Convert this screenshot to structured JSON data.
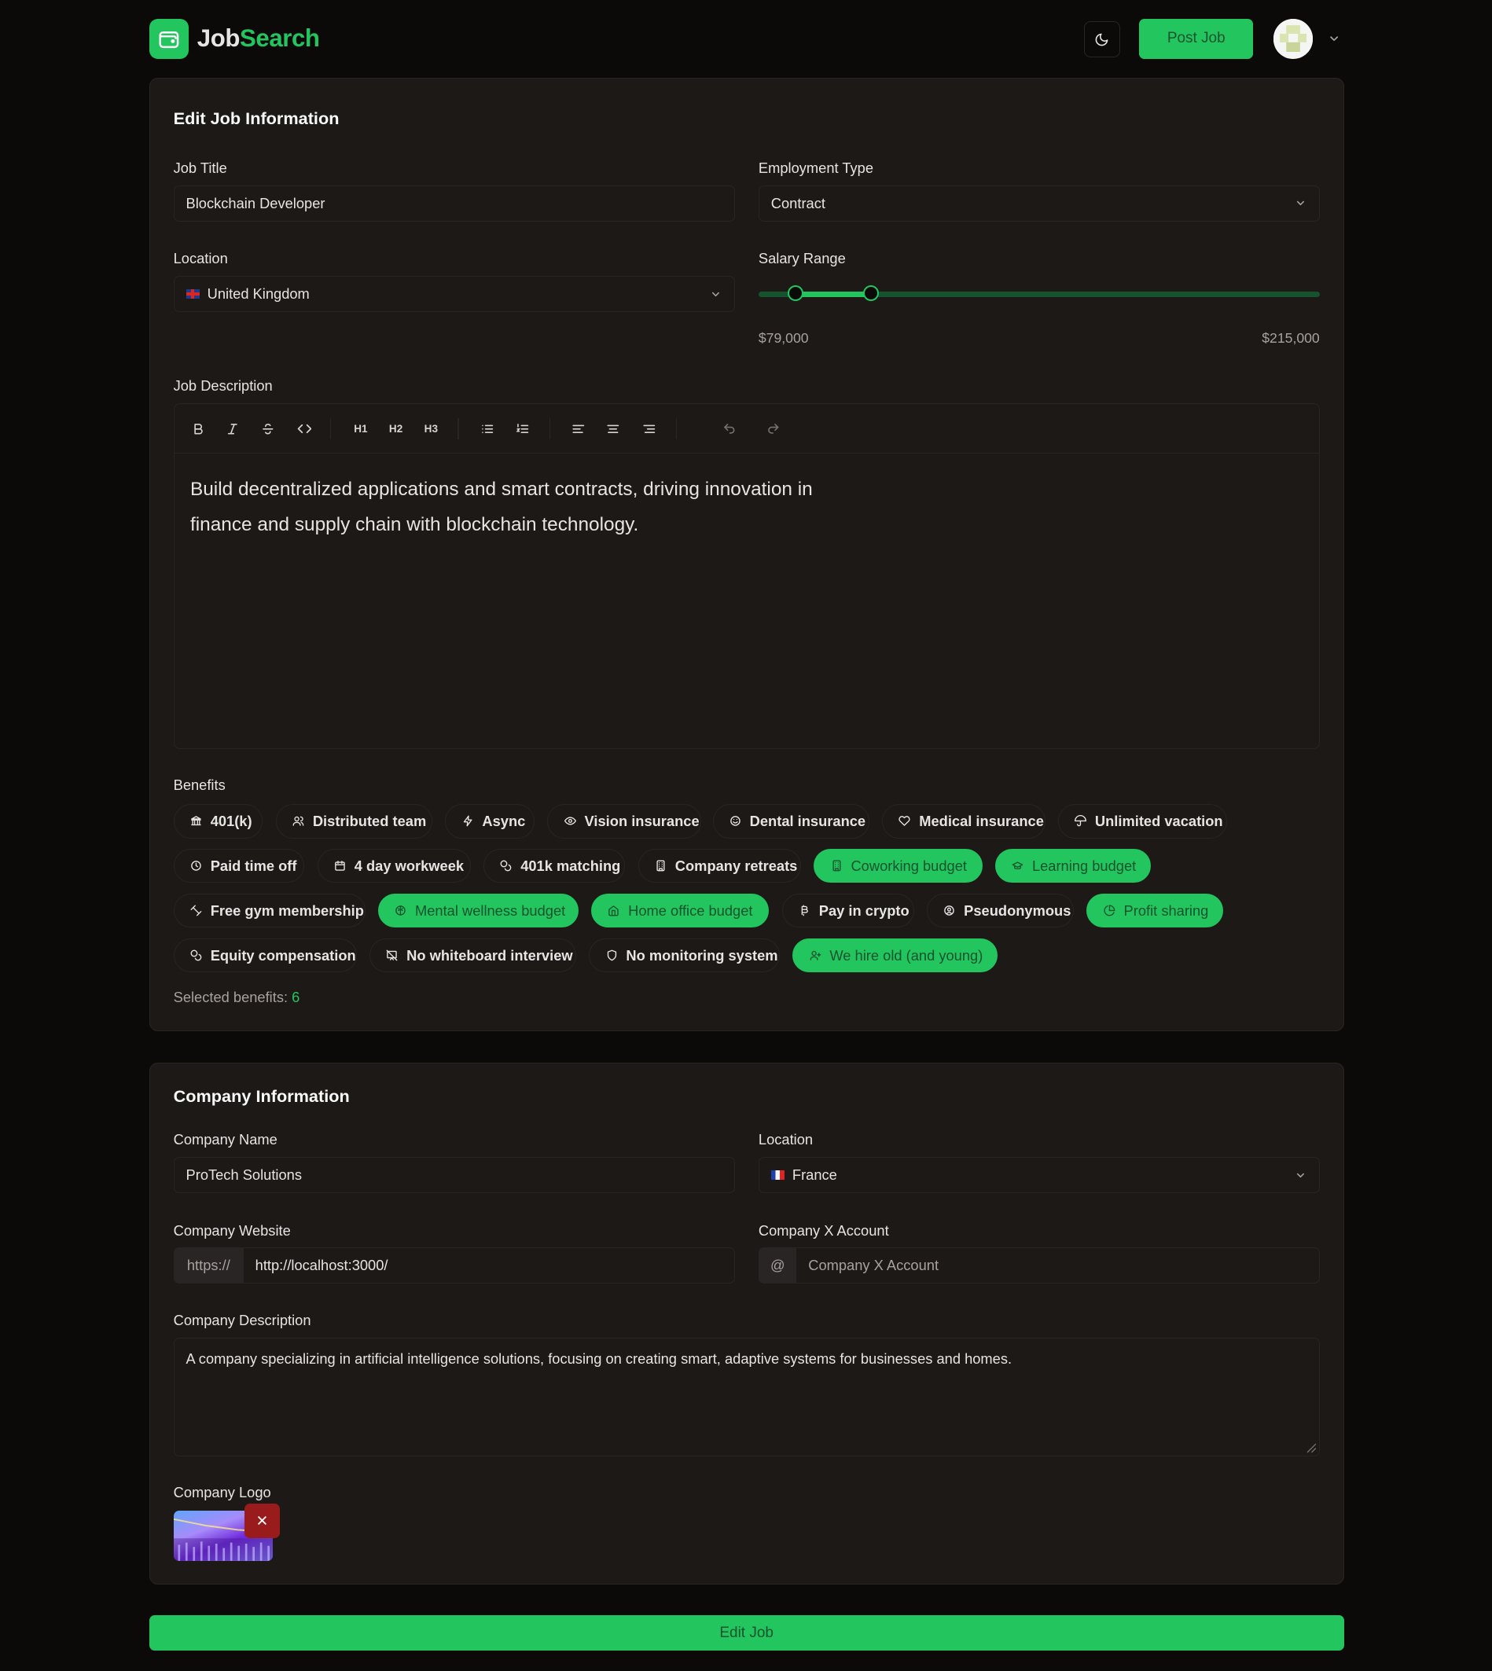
{
  "header": {
    "brand_part1": "Job",
    "brand_part2": "Search",
    "post_job_label": "Post Job",
    "accent": "#22c55e"
  },
  "job": {
    "title": "Edit Job Information",
    "job_title_label": "Job Title",
    "job_title_value": "Blockchain Developer",
    "employment_type_label": "Employment Type",
    "employment_type_value": "Contract",
    "location_label": "Location",
    "location_value": "United Kingdom",
    "salary_label": "Salary Range",
    "salary_min": "$79,000",
    "salary_max": "$215,000",
    "salary_range_low_fraction": 0.066,
    "salary_range_high_fraction": 0.2,
    "description_label": "Job Description",
    "description_text": "Build decentralized applications and smart contracts, driving innovation in finance and supply chain with blockchain technology.",
    "toolbar": {
      "h1": "H1",
      "h2": "H2",
      "h3": "H3"
    }
  },
  "benefits": {
    "label": "Benefits",
    "items": [
      {
        "label": "401(k)",
        "icon": "bank-icon",
        "selected": false
      },
      {
        "label": "Distributed team",
        "icon": "users-icon",
        "selected": false
      },
      {
        "label": "Async",
        "icon": "bolt-icon",
        "selected": false
      },
      {
        "label": "Vision insurance",
        "icon": "eye-icon",
        "selected": false
      },
      {
        "label": "Dental insurance",
        "icon": "smile-icon",
        "selected": false
      },
      {
        "label": "Medical insurance",
        "icon": "heart-icon",
        "selected": false
      },
      {
        "label": "Unlimited vacation",
        "icon": "umbrella-icon",
        "selected": false
      },
      {
        "label": "Paid time off",
        "icon": "clock-icon",
        "selected": false
      },
      {
        "label": "4 day workweek",
        "icon": "calendar-icon",
        "selected": false
      },
      {
        "label": "401k matching",
        "icon": "coins-icon",
        "selected": false
      },
      {
        "label": "Company retreats",
        "icon": "building-icon",
        "selected": false
      },
      {
        "label": "Coworking budget",
        "icon": "building-icon",
        "selected": true
      },
      {
        "label": "Learning budget",
        "icon": "graduation-cap-icon",
        "selected": true
      },
      {
        "label": "Free gym membership",
        "icon": "dumbbell-icon",
        "selected": false
      },
      {
        "label": "Mental wellness budget",
        "icon": "brain-icon",
        "selected": true
      },
      {
        "label": "Home office budget",
        "icon": "home-icon",
        "selected": true
      },
      {
        "label": "Pay in crypto",
        "icon": "bitcoin-icon",
        "selected": false
      },
      {
        "label": "Pseudonymous",
        "icon": "user-circle-icon",
        "selected": false
      },
      {
        "label": "Profit sharing",
        "icon": "pie-chart-icon",
        "selected": true
      },
      {
        "label": "Equity compensation",
        "icon": "coins-icon",
        "selected": false
      },
      {
        "label": "No whiteboard interview",
        "icon": "whiteboard-off-icon",
        "selected": false
      },
      {
        "label": "No monitoring system",
        "icon": "shield-icon",
        "selected": false
      },
      {
        "label": "We hire old (and young)",
        "icon": "user-plus-icon",
        "selected": true
      }
    ],
    "selected_label": "Selected benefits:",
    "selected_count": "6"
  },
  "company": {
    "title": "Company Information",
    "name_label": "Company Name",
    "name_value": "ProTech Solutions",
    "location_label": "Location",
    "location_value": "France",
    "website_label": "Company Website",
    "website_prefix": "https://",
    "website_value": "http://localhost:3000/",
    "x_label": "Company X Account",
    "x_prefix": "@",
    "x_placeholder": "Company X Account",
    "description_label": "Company Description",
    "description_value": "A company specializing in artificial intelligence solutions, focusing on creating smart, adaptive systems for businesses and homes.",
    "logo_label": "Company Logo"
  },
  "submit_label": "Edit Job"
}
